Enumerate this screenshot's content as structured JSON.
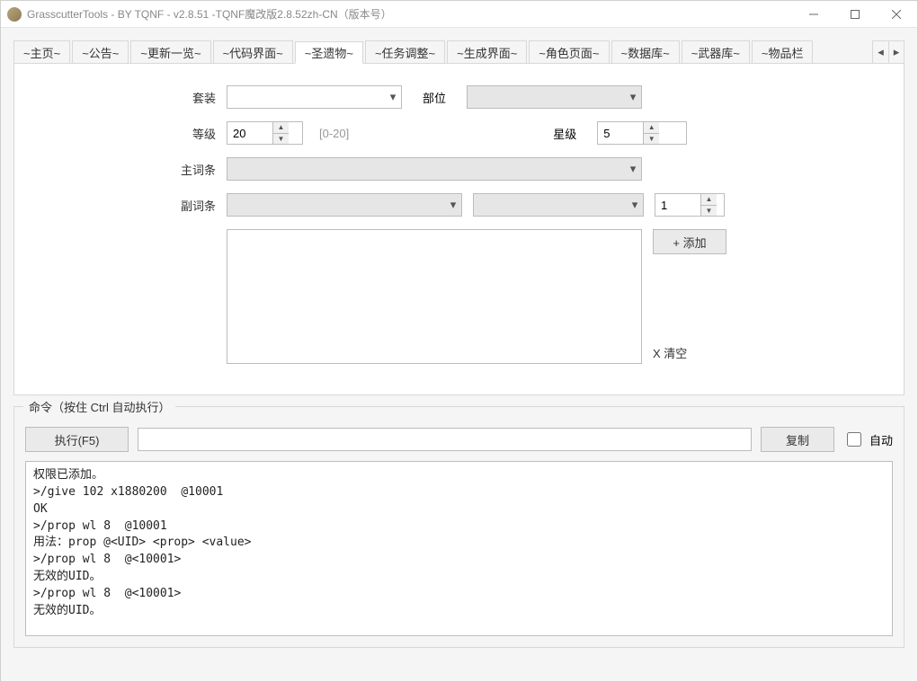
{
  "title": "GrasscutterTools  - BY TQNF  - v2.8.51 -TQNF魔改版2.8.52zh-CN（版本号）",
  "tabs": [
    "~主页~",
    "~公告~",
    "~更新一览~",
    "~代码界面~",
    "~圣遗物~",
    "~任务调整~",
    "~生成界面~",
    "~角色页面~",
    "~数据库~",
    "~武器库~",
    "~物品栏"
  ],
  "activeTab": 4,
  "form": {
    "setLabel": "套装",
    "slotLabel": "部位",
    "levelLabel": "等级",
    "levelValue": "20",
    "levelHint": "[0-20]",
    "starLabel": "星级",
    "starValue": "5",
    "mainStatLabel": "主词条",
    "subStatLabel": "副词条",
    "subStatCountValue": "1",
    "addBtn": "+ 添加",
    "clearBtn": "X 清空"
  },
  "cmd": {
    "legend": "命令（按住 Ctrl 自动执行）",
    "execBtn": "执行(F5)",
    "inputValue": "",
    "copyBtn": "复制",
    "autoLabel": "自动"
  },
  "consoleText": "权限已添加。\n>/give 102 x1880200  @10001\nOK\n>/prop wl 8  @10001\n用法：prop @<UID> <prop> <value>\n>/prop wl 8  @<10001>\n无效的UID。\n>/prop wl 8  @<10001>\n无效的UID。"
}
